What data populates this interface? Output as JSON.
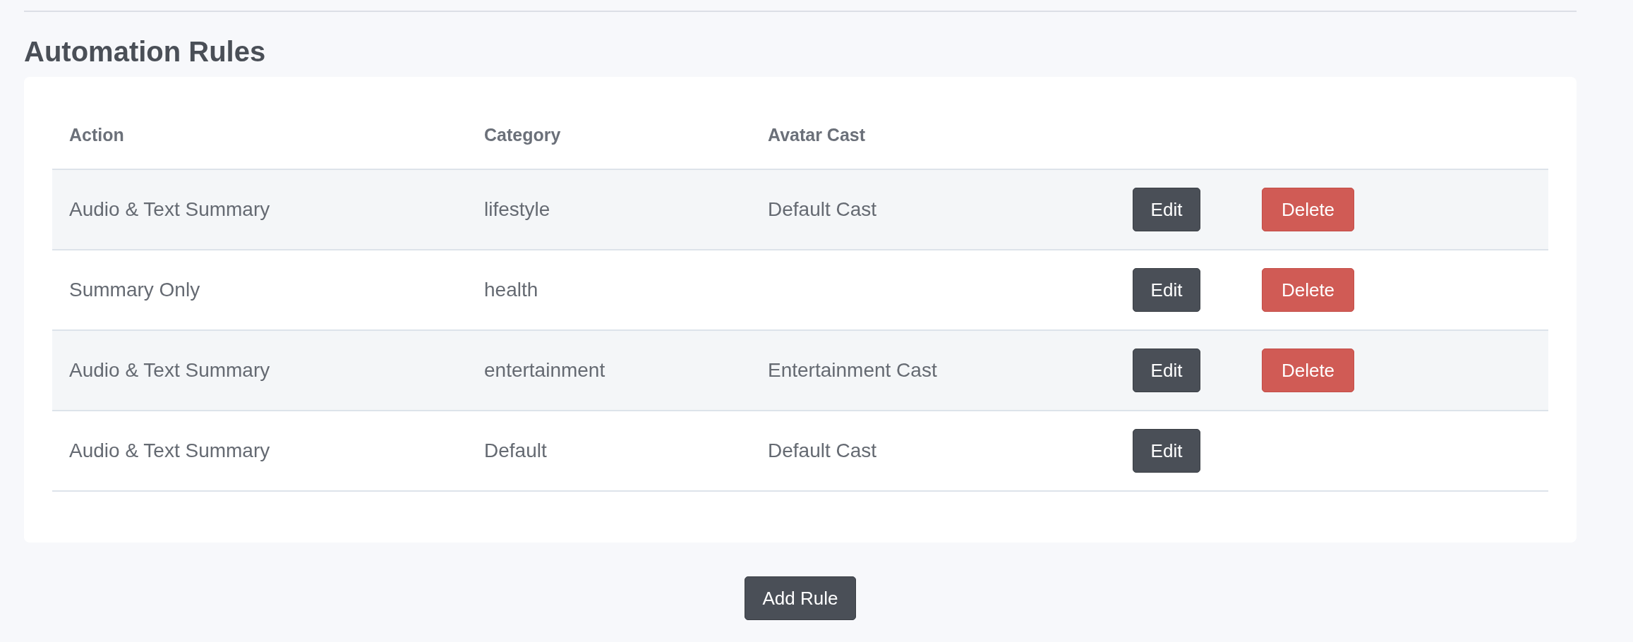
{
  "title": "Automation Rules",
  "table": {
    "columns": [
      "Action",
      "Category",
      "Avatar Cast"
    ],
    "rows": [
      {
        "action": "Audio & Text Summary",
        "category": "lifestyle",
        "avatar_cast": "Default Cast",
        "actions": [
          {
            "kind": "edit",
            "label": "Edit"
          },
          {
            "kind": "delete",
            "label": "Delete"
          }
        ]
      },
      {
        "action": "Summary Only",
        "category": "health",
        "actions": [
          {
            "kind": "edit",
            "label": "Edit"
          },
          {
            "kind": "delete",
            "label": "Delete"
          }
        ]
      },
      {
        "action": "Audio & Text Summary",
        "category": "entertainment",
        "avatar_cast": "Entertainment Cast",
        "actions": [
          {
            "kind": "edit",
            "label": "Edit"
          },
          {
            "kind": "delete",
            "label": "Delete"
          }
        ]
      },
      {
        "action": "Audio & Text Summary",
        "category": "Default",
        "avatar_cast": "Default Cast",
        "actions": [
          {
            "kind": "edit",
            "label": "Edit"
          }
        ]
      }
    ]
  },
  "add_button": "Add Rule"
}
